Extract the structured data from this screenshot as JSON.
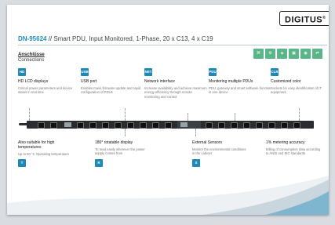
{
  "brand": {
    "logo": "DIGITUS",
    "trademark": "®"
  },
  "header": {
    "model": "DN-95624",
    "separator": "//",
    "description": "Smart PDU, Input Monitored, 1-Phase, 20 x C13, 4 x C19"
  },
  "section": {
    "title": "Anschlüsse",
    "subtitle": "Connections"
  },
  "feature_icons": [
    "",
    "",
    "",
    "",
    "",
    ""
  ],
  "colors": {
    "accent": "#1e88b8",
    "model": "#1e8fbf",
    "badge": "#5bb58a",
    "bar": "#2a2c2f"
  },
  "features_top": [
    {
      "icon": "HD",
      "title": "HD LCD displays",
      "desc": "Critical power parameters and device status in real time"
    },
    {
      "icon": "USB",
      "title": "USB port",
      "desc": "Enables mass firmware update and rapid configuration of PDUs"
    },
    {
      "icon": "NET",
      "title": "Network interface",
      "desc": "Increase availability and achieve maximum energy efficiency through remote monitoring and control"
    },
    {
      "icon": "PDU",
      "title": "Monitoring multiple PDUs",
      "desc": "PDU, gateway and smart software function in one device"
    },
    {
      "icon": "CLR",
      "title": "Customized color",
      "desc": "Sockets for easy identification of IT equipment"
    }
  ],
  "features_bottom": [
    {
      "icon": "T",
      "title": "Also suitable for high temperatures",
      "desc": "Up to 60 °C Operating temperature"
    },
    {
      "icon": "R",
      "title": "180° rotatable display",
      "desc": "To read easily wherever the power supply comes from"
    },
    {
      "icon": "S",
      "title": "External Sensors",
      "desc": "Monitor the environmental conditions in the cabinet"
    },
    {
      "icon": "1%",
      "title": "1% metering accuracy",
      "desc": "Billing of consumption data according to ANSI and IEC standards"
    }
  ]
}
